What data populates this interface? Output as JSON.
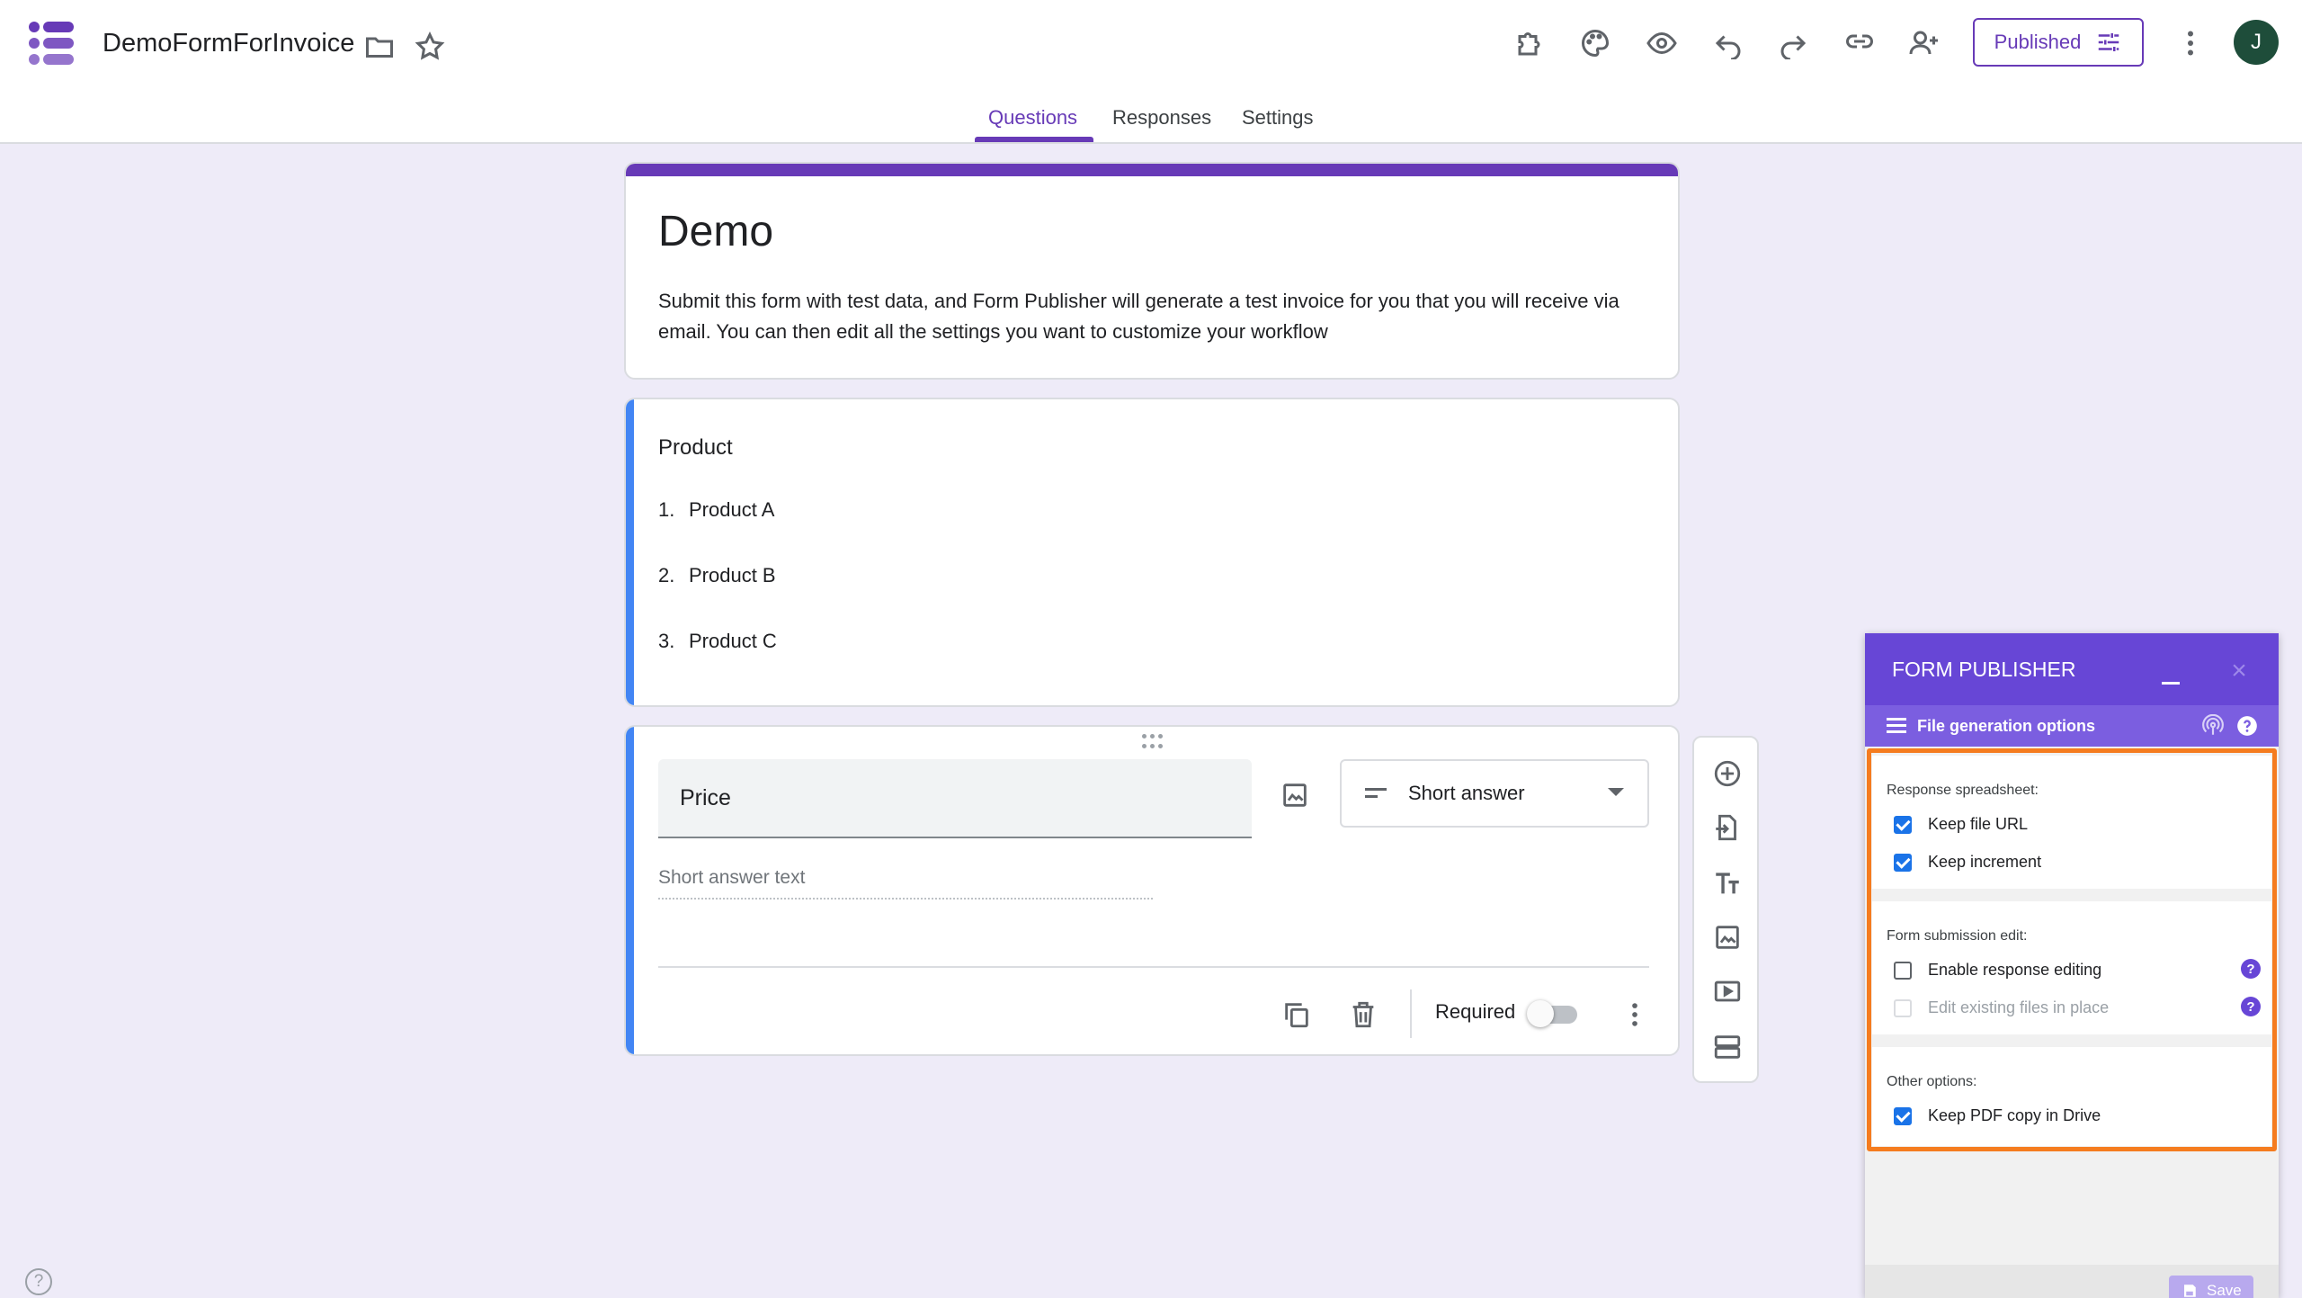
{
  "header": {
    "doc_title": "DemoFormForInvoice",
    "published_label": "Published",
    "avatar_initial": "J",
    "brand_color": "#673ab7"
  },
  "tabs": [
    {
      "label": "Questions",
      "active": true
    },
    {
      "label": "Responses",
      "active": false
    },
    {
      "label": "Settings",
      "active": false
    }
  ],
  "form": {
    "title": "Demo",
    "description": "Submit this form with test data, and Form Publisher will generate a test invoice for you that you will receive via email. You can then edit all the settings you want to customize your workflow"
  },
  "product_question": {
    "title": "Product",
    "items": [
      {
        "num": "1.",
        "label": "Product A"
      },
      {
        "num": "2.",
        "label": "Product B"
      },
      {
        "num": "3.",
        "label": "Product C"
      }
    ]
  },
  "price_question": {
    "title": "Price",
    "type_label": "Short answer",
    "placeholder": "Short answer text",
    "required_label": "Required",
    "required_on": false
  },
  "form_publisher": {
    "header": "FORM PUBLISHER",
    "subheader": "File generation options",
    "close_glyph": "×",
    "sections": [
      {
        "title": "Response spreadsheet:",
        "options": [
          {
            "label": "Keep file URL",
            "checked": true
          },
          {
            "label": "Keep increment",
            "checked": true
          }
        ]
      },
      {
        "title": "Form submission edit:",
        "options": [
          {
            "label": "Enable response editing",
            "checked": false
          },
          {
            "label": "Edit existing files in place",
            "checked": false,
            "disabled": true
          }
        ]
      },
      {
        "title": "Other options:",
        "options": [
          {
            "label": "Keep PDF copy in Drive",
            "checked": true
          }
        ]
      }
    ],
    "help_glyph": "?",
    "save_label": "Save",
    "highlight_color": "#f57c1f"
  },
  "page_help_glyph": "?"
}
